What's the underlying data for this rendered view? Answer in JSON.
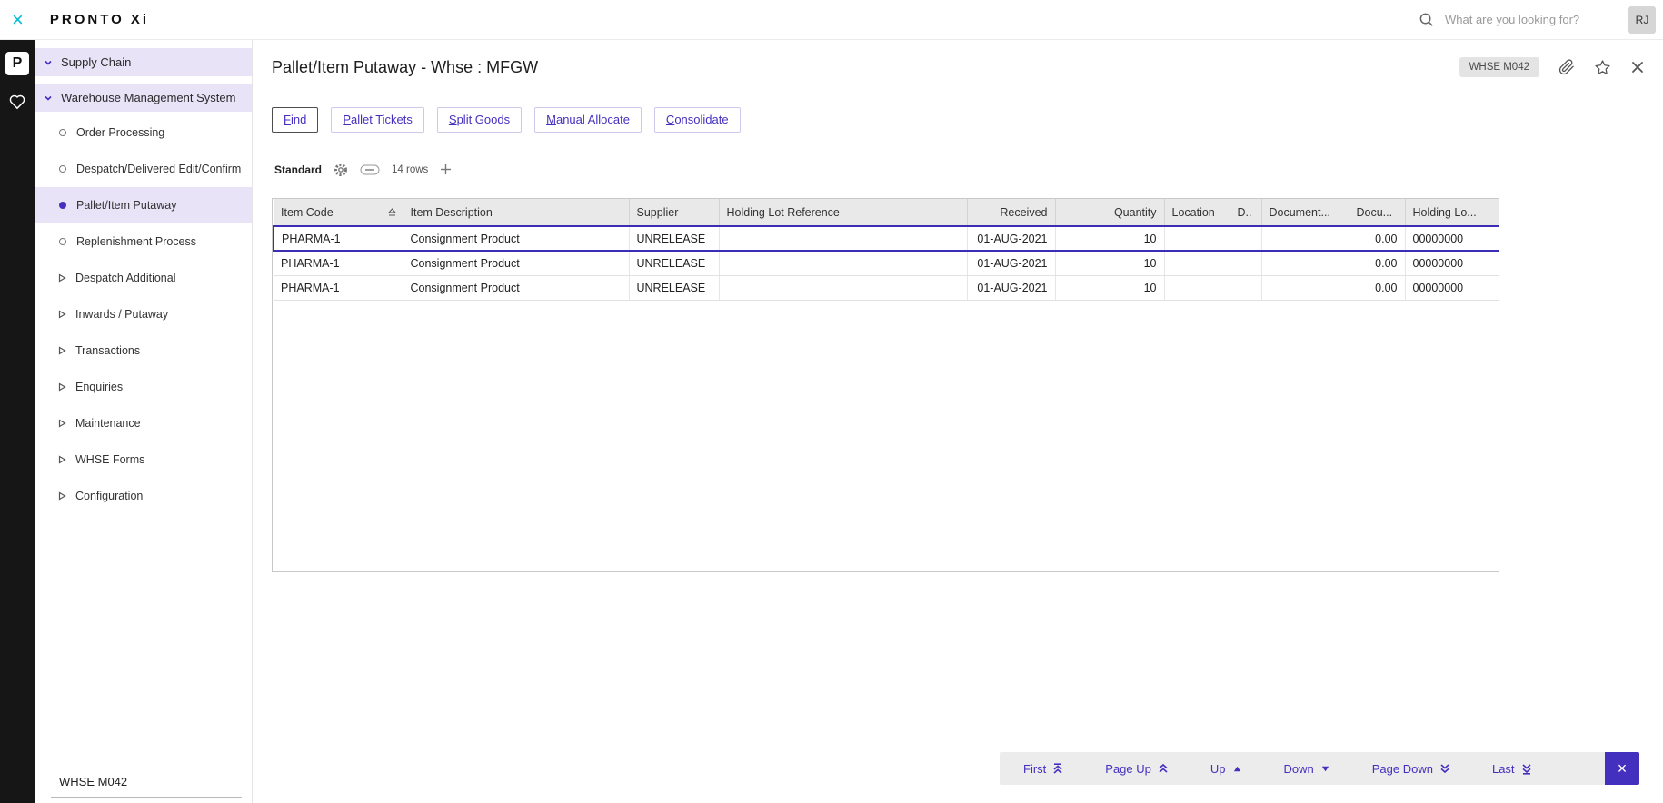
{
  "topbar": {
    "close_glyph": "×",
    "logo": "PRONTO Xi",
    "search_placeholder": "What are you looking for?",
    "avatar_initials": "RJ"
  },
  "rail": {
    "logo_glyph": "P"
  },
  "sidebar": {
    "sections": [
      {
        "label": "Supply Chain"
      },
      {
        "label": "Warehouse Management System"
      }
    ],
    "items": [
      {
        "label": "Order Processing"
      },
      {
        "label": "Despatch/Delivered Edit/Confirm"
      },
      {
        "label": "Pallet/Item Putaway"
      },
      {
        "label": "Replenishment Process"
      }
    ],
    "groups": [
      {
        "label": "Despatch Additional"
      },
      {
        "label": "Inwards / Putaway"
      },
      {
        "label": "Transactions"
      },
      {
        "label": "Enquiries"
      },
      {
        "label": "Maintenance"
      },
      {
        "label": "WHSE Forms"
      },
      {
        "label": "Configuration"
      }
    ],
    "footer": "WHSE M042"
  },
  "main": {
    "title": "Pallet/Item Putaway - Whse : MFGW",
    "warehouse_badge": "WHSE M042",
    "tabs": [
      {
        "mnemonic": "F",
        "rest": "ind"
      },
      {
        "mnemonic": "P",
        "rest": "allet Tickets"
      },
      {
        "mnemonic": "S",
        "rest": "plit Goods"
      },
      {
        "mnemonic": "M",
        "rest": "anual Allocate"
      },
      {
        "mnemonic": "C",
        "rest": "onsolidate"
      }
    ],
    "toolbar": {
      "view": "Standard",
      "row_count": "14 rows"
    }
  },
  "table": {
    "headers": [
      "Item Code",
      "Item Description",
      "Supplier",
      "Holding Lot Reference",
      "Received",
      "Quantity",
      "Location",
      "D..",
      "Document...",
      "Docu...",
      "Holding Lo..."
    ],
    "rows": [
      [
        "PHARMA-1",
        "Consignment Product",
        "UNRELEASE",
        "",
        "01-AUG-2021",
        "10",
        "",
        "",
        "",
        "0.00",
        "00000000"
      ],
      [
        "PHARMA-1",
        "Consignment Product",
        "UNRELEASE",
        "",
        "01-AUG-2021",
        "10",
        "",
        "",
        "",
        "0.00",
        "00000000"
      ],
      [
        "PHARMA-1",
        "Consignment Product",
        "UNRELEASE",
        "",
        "01-AUG-2021",
        "10",
        "",
        "",
        "",
        "0.00",
        "00000000"
      ]
    ]
  },
  "nav": {
    "first": "First",
    "page_up": "Page Up",
    "up": "Up",
    "down": "Down",
    "page_down": "Page Down",
    "last": "Last",
    "close_glyph": "×"
  },
  "colors": {
    "accent": "#4430bf",
    "accent_light": "#e9e3f8",
    "teal": "#00bcd4",
    "grid_header": "#e9e9e9",
    "rail_bg": "#161616",
    "selected_border": "#3b2eb5"
  }
}
